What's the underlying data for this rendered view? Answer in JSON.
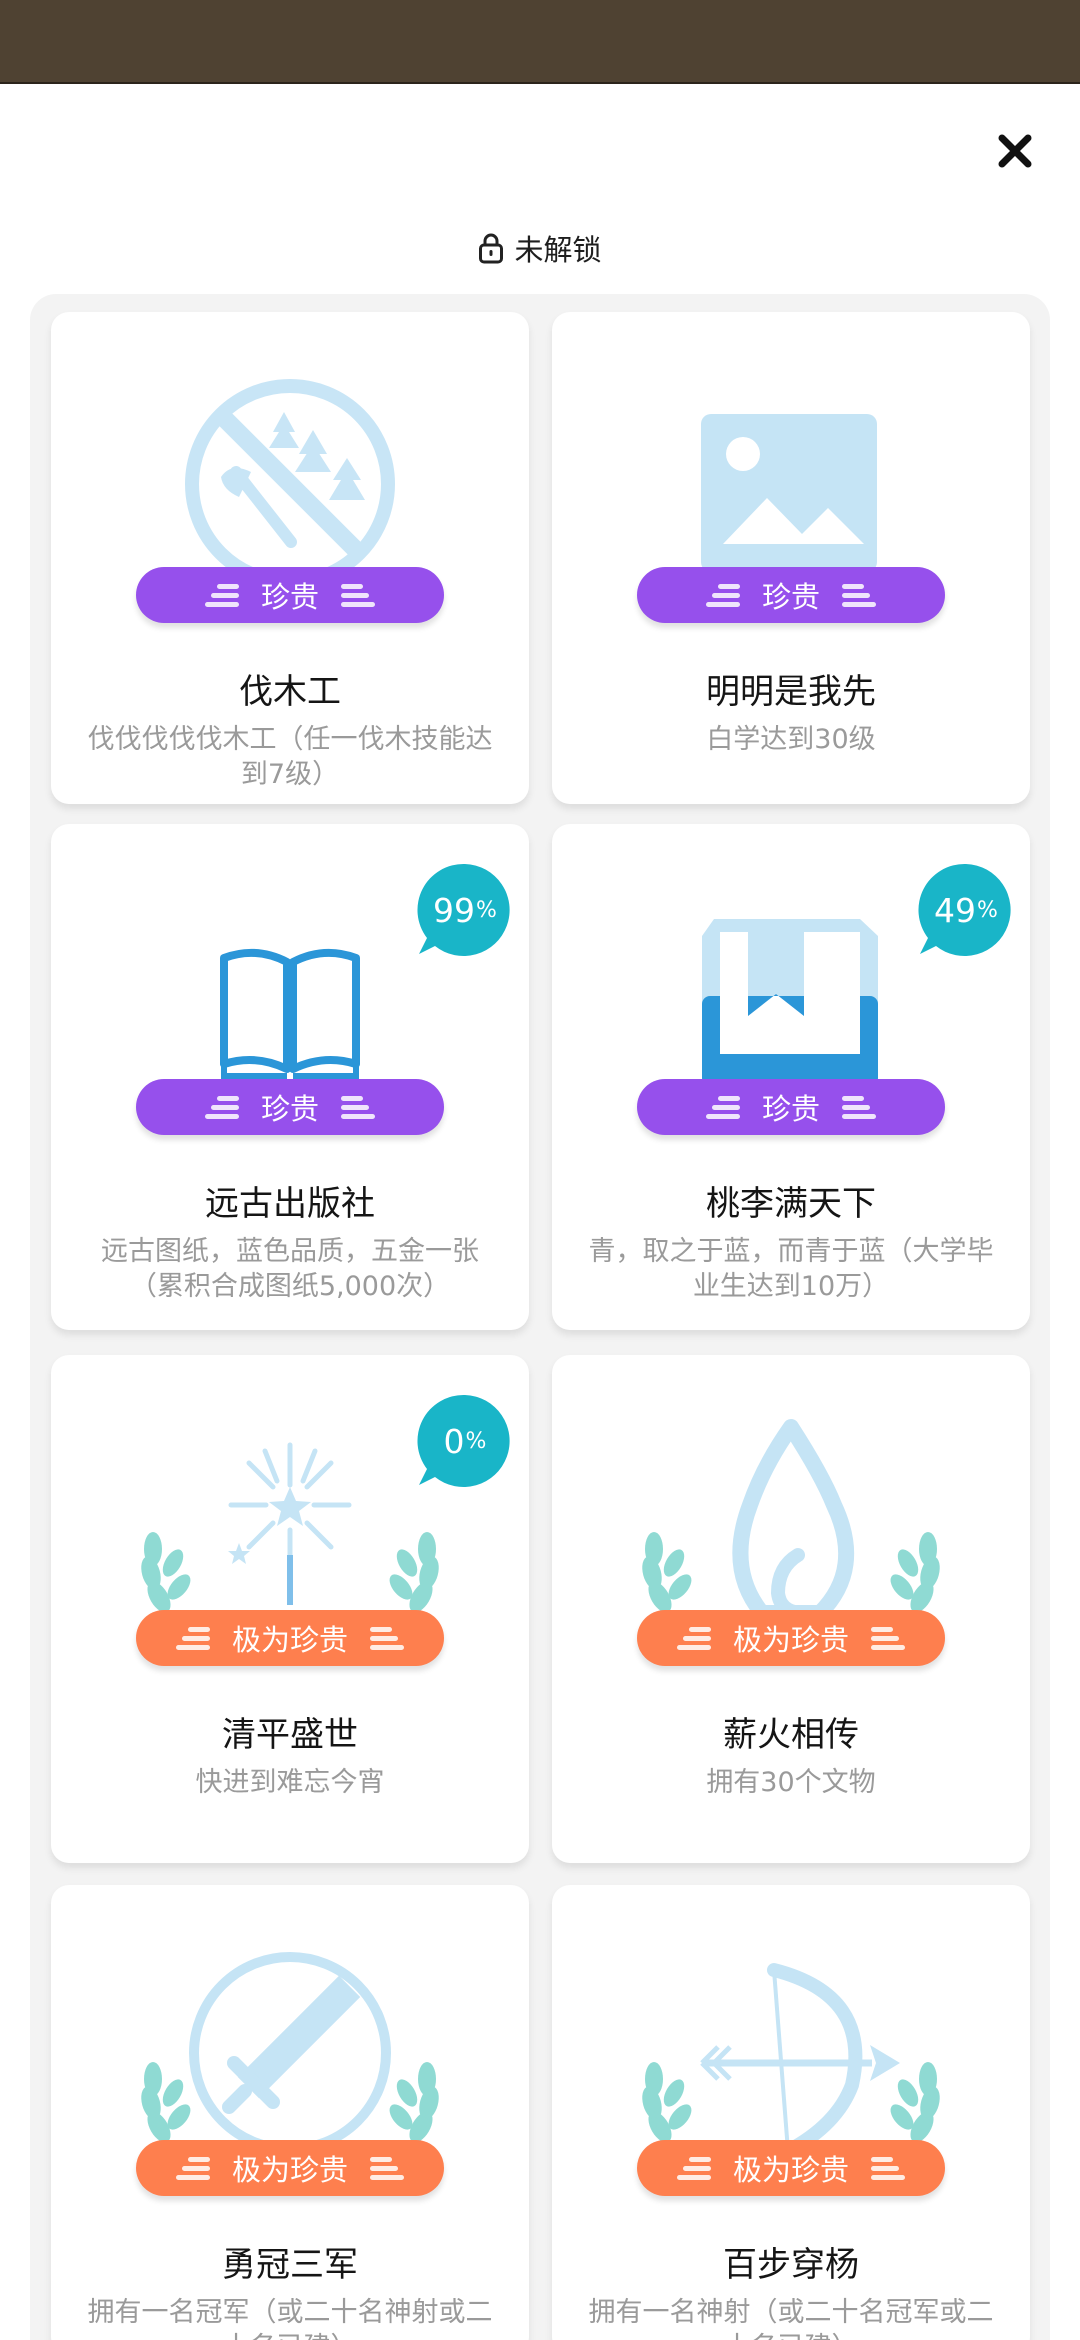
{
  "header": {
    "title": "未解锁",
    "lock_icon": "lock-icon",
    "close_icon": "close-icon"
  },
  "colors": {
    "top_strip": "#4f4232",
    "badge_precious": "#9650ec",
    "badge_very_precious": "#fe7f4e",
    "progress_bubble": "#19b5c8",
    "art_light_blue": "#c5e4f5",
    "wreath_green": "#8fdad3"
  },
  "achievements": [
    {
      "title": "伐木工",
      "desc": "伐伐伐伐伐木工（任一伐木技能达到7级）",
      "rarity": "珍贵",
      "icon": "no-logging-icon"
    },
    {
      "title": "明明是我先",
      "desc": "白学达到30级",
      "rarity": "珍贵",
      "icon": "image-placeholder-icon"
    },
    {
      "title": "远古出版社",
      "desc": "远古图纸，蓝色品质，五金一张（累积合成图纸5,000次）",
      "rarity": "珍贵",
      "icon": "open-book-icon",
      "progress": "99",
      "progress_unit": "%"
    },
    {
      "title": "桃李满天下",
      "desc": "青，取之于蓝，而青于蓝（大学毕业生达到10万）",
      "rarity": "珍贵",
      "icon": "bookmark-book-icon",
      "progress": "49",
      "progress_unit": "%"
    },
    {
      "title": "清平盛世",
      "desc": "快进到难忘今宵",
      "rarity": "极为珍贵",
      "icon": "fireworks-icon",
      "progress": "0",
      "progress_unit": "%"
    },
    {
      "title": "薪火相传",
      "desc": "拥有30个文物",
      "rarity": "极为珍贵",
      "icon": "flame-icon"
    },
    {
      "title": "勇冠三军",
      "desc": "拥有一名冠军（或二十名神射或二十名已建）",
      "rarity": "极为珍贵",
      "icon": "sword-icon"
    },
    {
      "title": "百步穿杨",
      "desc": "拥有一名神射（或二十名冠军或二十名已建）",
      "rarity": "极为珍贵",
      "icon": "bow-arrow-icon"
    }
  ]
}
